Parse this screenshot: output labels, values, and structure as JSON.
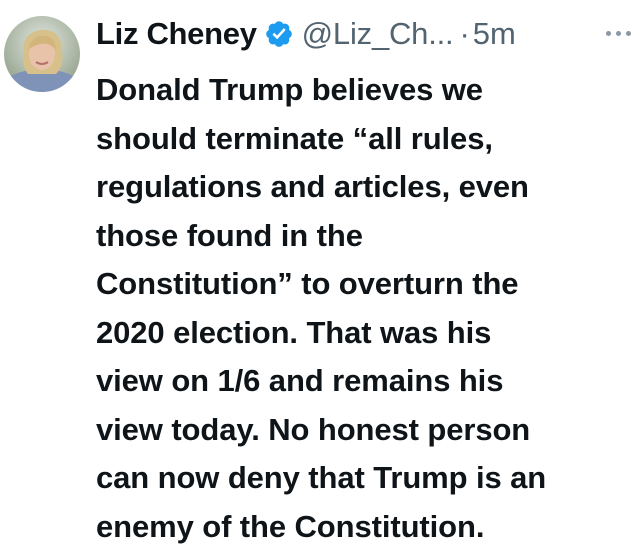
{
  "author": {
    "name": "Liz Cheney",
    "handle": "@Liz_Ch...",
    "dot": "·",
    "time": "5m",
    "verified_color": "#1d9bf0"
  },
  "tweet": {
    "lines": [
      "Donald Trump believes we",
      "should terminate “all rules,",
      "regulations and articles, even",
      "those found in the",
      "Constitution” to overturn the",
      "2020 election. That was his",
      "view on 1/6 and remains his",
      "view today. No honest person",
      "can now deny that Trump is an",
      "enemy of the Constitution."
    ]
  },
  "icons": {
    "avatar": "profile-photo",
    "verified": "verified-badge-icon",
    "more": "more-options-icon"
  }
}
